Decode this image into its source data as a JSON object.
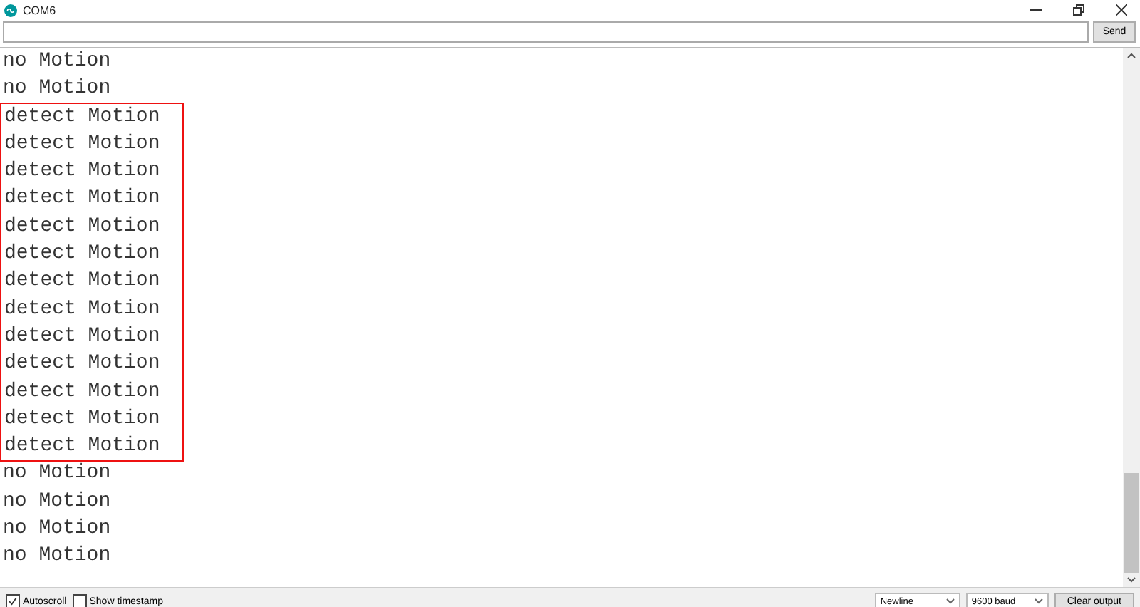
{
  "window": {
    "title": "COM6"
  },
  "send_button": "Send",
  "output": {
    "groups": [
      {
        "highlighted": false,
        "lines": [
          "no Motion",
          "no Motion"
        ]
      },
      {
        "highlighted": true,
        "lines": [
          "detect Motion",
          "detect Motion",
          "detect Motion",
          "detect Motion",
          "detect Motion",
          "detect Motion",
          "detect Motion",
          "detect Motion",
          "detect Motion",
          "detect Motion",
          "detect Motion",
          "detect Motion",
          "detect Motion"
        ]
      },
      {
        "highlighted": false,
        "lines": [
          "no Motion",
          "no Motion",
          "no Motion",
          "no Motion"
        ]
      }
    ]
  },
  "footer": {
    "checkboxes": [
      {
        "label": "Autoscroll",
        "checked": true
      },
      {
        "label": "Show timestamp",
        "checked": false
      }
    ],
    "line_ending": "Newline",
    "baud_rate": "9600 baud",
    "clear_button": "Clear output"
  }
}
